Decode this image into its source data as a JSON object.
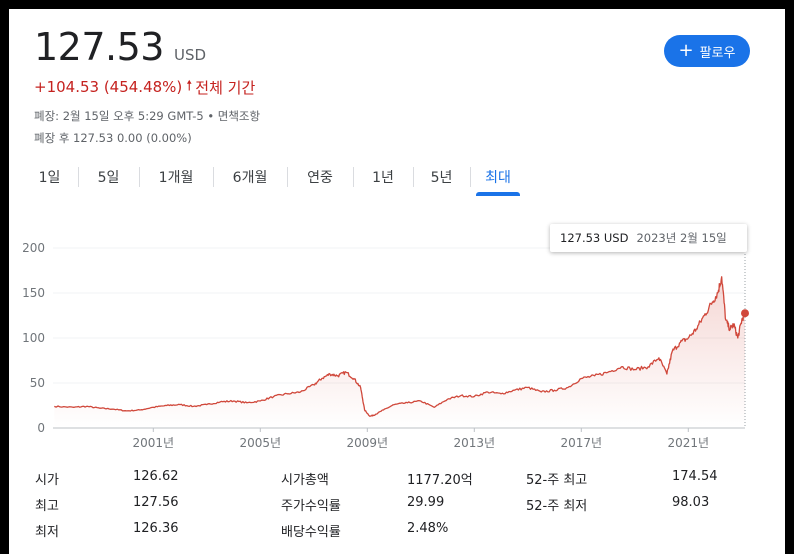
{
  "quote": {
    "price": "127.53",
    "currency": "USD",
    "change": "+104.53 (454.48%)",
    "period": "전체 기간",
    "close_info": "폐장: 2월 15일 오후 5:29 GMT-5 • 면책조항",
    "after_hours": "폐장 후 127.53 0.00 (0.00%)"
  },
  "follow_button": {
    "label": "팔로우",
    "icon": "plus-icon"
  },
  "tabs": [
    {
      "label": "1일"
    },
    {
      "label": "5일"
    },
    {
      "label": "1개월"
    },
    {
      "label": "6개월"
    },
    {
      "label": "연중"
    },
    {
      "label": "1년"
    },
    {
      "label": "5년"
    },
    {
      "label": "최대",
      "active": true
    }
  ],
  "tooltip": {
    "price": "127.53 USD",
    "date": "2023년 2월 15일"
  },
  "colors": {
    "line": "#d0483b",
    "accent": "#1a73e8",
    "change": "#c5221f"
  },
  "chart_data": {
    "type": "line",
    "ylim": [
      0,
      200
    ],
    "yticks": [
      0,
      50,
      100,
      150,
      200
    ],
    "xticks": [
      "2001년",
      "2005년",
      "2009년",
      "2013년",
      "2017년",
      "2021년"
    ],
    "xtick_years": [
      2001,
      2005,
      2009,
      2013,
      2017,
      2021
    ],
    "xlim": [
      1997.25,
      2023.12
    ],
    "series": [
      {
        "x": [
          1997.3,
          1998.0,
          1998.5,
          1999.0,
          1999.5,
          2000.0,
          2000.5,
          2001.0,
          2001.5,
          2002.0,
          2002.5,
          2003.0,
          2003.5,
          2004.0,
          2004.5,
          2005.0,
          2005.5,
          2006.0,
          2006.5,
          2007.0,
          2007.3,
          2007.6,
          2007.9,
          2008.2,
          2008.5,
          2008.75,
          2008.9,
          2009.1,
          2009.3,
          2009.6,
          2010.0,
          2010.5,
          2011.0,
          2011.5,
          2012.0,
          2012.5,
          2013.0,
          2013.5,
          2014.0,
          2014.5,
          2015.0,
          2015.5,
          2016.0,
          2016.5,
          2017.0,
          2017.5,
          2018.0,
          2018.5,
          2019.0,
          2019.5,
          2019.9,
          2020.2,
          2020.4,
          2020.7,
          2021.0,
          2021.3,
          2021.6,
          2021.9,
          2022.1,
          2022.25,
          2022.4,
          2022.55,
          2022.7,
          2022.85,
          2023.0,
          2023.12
        ],
        "y": [
          24,
          23,
          24,
          22,
          21,
          19,
          20,
          23,
          25,
          26,
          24,
          26,
          29,
          30,
          28,
          30,
          35,
          38,
          40,
          48,
          55,
          60,
          58,
          62,
          55,
          45,
          20,
          13,
          15,
          20,
          26,
          28,
          30,
          23,
          32,
          36,
          35,
          40,
          38,
          42,
          45,
          40,
          42,
          45,
          55,
          58,
          62,
          68,
          65,
          68,
          78,
          60,
          85,
          95,
          100,
          110,
          125,
          140,
          150,
          168,
          120,
          110,
          115,
          100,
          120,
          127.53
        ]
      }
    ]
  },
  "stats": [
    {
      "l1": "시가",
      "v1": "126.62",
      "l2": "시가총액",
      "v2": "1177.20억",
      "l3": "52-주 최고",
      "v3": "174.54"
    },
    {
      "l1": "최고",
      "v1": "127.56",
      "l2": "주가수익률",
      "v2": "29.99",
      "l3": "52-주 최저",
      "v3": "98.03"
    },
    {
      "l1": "최저",
      "v1": "126.36",
      "l2": "배당수익률",
      "v2": "2.48%"
    }
  ]
}
